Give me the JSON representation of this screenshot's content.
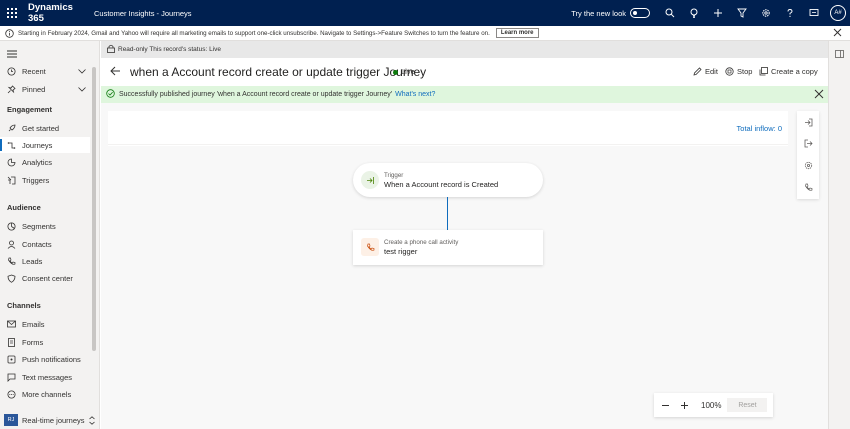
{
  "topbar": {
    "brand": "Dynamics 365",
    "app_name": "Customer Insights - Journeys",
    "try_new_look": "Try the new look",
    "avatar_initials": "A#",
    "icons": [
      "search-icon",
      "lightbulb-icon",
      "plus-icon",
      "filter-icon",
      "gear-icon",
      "help-icon",
      "chat-icon"
    ]
  },
  "notice": {
    "text": "Starting in February 2024, Gmail and Yahoo will require all marketing emails to support one-click unsubscribe. Navigate to Settings->Feature Switches to turn the feature on.",
    "learn_more": "Learn more"
  },
  "nav": {
    "recent": "Recent",
    "pinned": "Pinned",
    "engagement_head": "Engagement",
    "get_started": "Get started",
    "journeys": "Journeys",
    "analytics": "Analytics",
    "triggers": "Triggers",
    "audience_head": "Audience",
    "segments": "Segments",
    "contacts": "Contacts",
    "leads": "Leads",
    "consent_center": "Consent center",
    "channels_head": "Channels",
    "emails": "Emails",
    "forms": "Forms",
    "push_notifications": "Push notifications",
    "text_messages": "Text messages",
    "more_channels": "More channels",
    "area_badge": "RJ",
    "area_label": "Real-time journeys"
  },
  "main": {
    "readonly": "Read-only This record's status: Live",
    "title": "when a Account record create or update trigger Journey",
    "status": "Live",
    "status_color": "#107c10",
    "commands": {
      "edit": "Edit",
      "stop": "Stop",
      "copy": "Create a copy"
    },
    "success": {
      "message": "Successfully published journey 'when a Account record create or update trigger Journey'",
      "link": "What's next?"
    },
    "total_inflow": "Total inflow: 0",
    "trigger_tile": {
      "label": "Trigger",
      "text": "When a Account record is Created"
    },
    "action_tile": {
      "label": "Create a phone call activity",
      "text": "test rigger"
    },
    "zoom": {
      "level": "100%",
      "reset": "Reset"
    }
  },
  "colors": {
    "topbar": "#002050",
    "accent": "#0f6cbd",
    "success_bg": "#dff6dd"
  }
}
